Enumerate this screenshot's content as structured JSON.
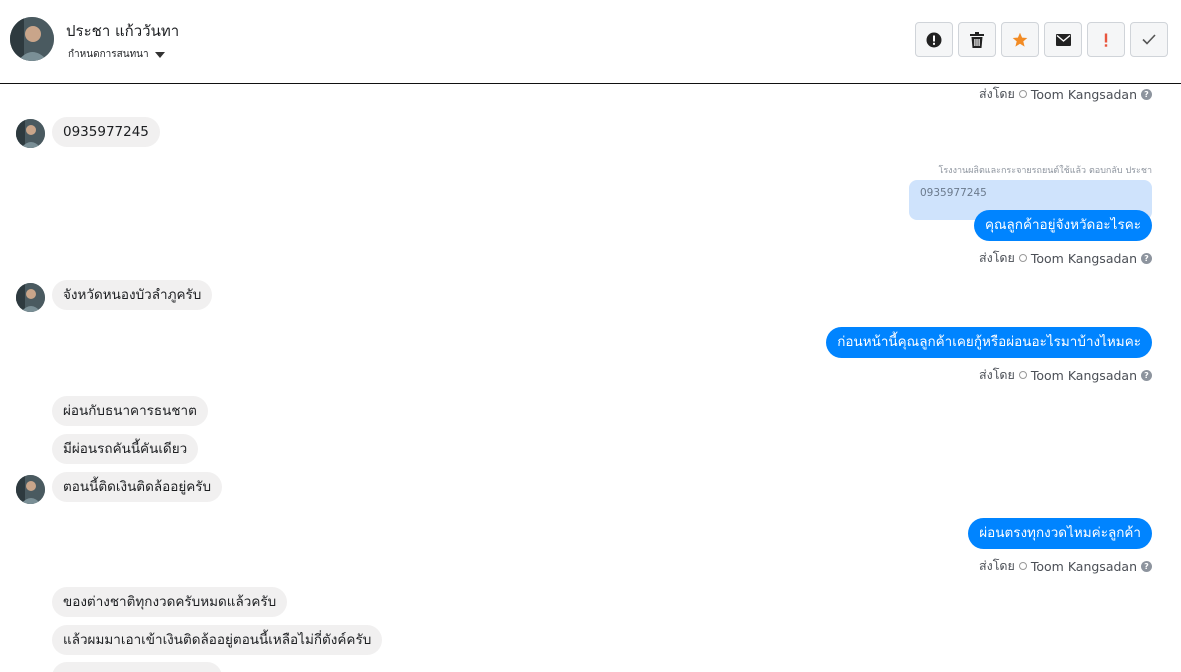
{
  "header": {
    "name": "ประชา แก้ววันทา",
    "assign_label": "กำหนดการสนทนา"
  },
  "toolbar": {
    "buttons": [
      {
        "name": "alert-button",
        "icon": "exclamation-circle-icon"
      },
      {
        "name": "delete-button",
        "icon": "trash-icon"
      },
      {
        "name": "star-button",
        "icon": "star-icon",
        "color": "#f28b24"
      },
      {
        "name": "mail-button",
        "icon": "envelope-icon"
      },
      {
        "name": "important-button",
        "icon": "exclamation-icon",
        "color": "#e8553e"
      },
      {
        "name": "done-button",
        "icon": "check-icon"
      }
    ]
  },
  "conversation": {
    "sent_prefix": "ส่งโดย",
    "agent": "Toom Kangsadan",
    "messages": [
      {
        "id": "m1",
        "text": "0935977245"
      },
      {
        "id": "m2_note",
        "text": "โรงงานผลิตและกระจายรถยนต์ใช้แล้ว ตอบกลับ ประชา"
      },
      {
        "id": "m2_quote",
        "text": "0935977245"
      },
      {
        "id": "m2",
        "text": "คุณลูกค้าอยู่จังหวัดอะไรคะ"
      },
      {
        "id": "m3",
        "text": "จังหวัดหนองบัวลำภูครับ"
      },
      {
        "id": "m4",
        "text": "ก่อนหน้านี้คุณลูกค้าเคยกู้หรือผ่อนอะไรมาบ้างไหมคะ"
      },
      {
        "id": "m5",
        "text": "ผ่อนกับธนาคารธนชาต"
      },
      {
        "id": "m6",
        "text": "มีผ่อนรถคันนี้คันเดียว"
      },
      {
        "id": "m7",
        "text": "ตอนนี้ติดเงินติดล้ออยู่ครับ"
      },
      {
        "id": "m8",
        "text": "ผ่อนตรงทุกงวดไหมค่ะลูกค้า"
      },
      {
        "id": "m9",
        "text": "ของต่างชาติทุกงวดครับหมดแล้วครับ"
      },
      {
        "id": "m10",
        "text": "แล้วผมมาเอาเข้าเงินติดล้ออยู่ตอนนี้เหลือไม่กี่ตังค์ครับ"
      }
    ]
  }
}
